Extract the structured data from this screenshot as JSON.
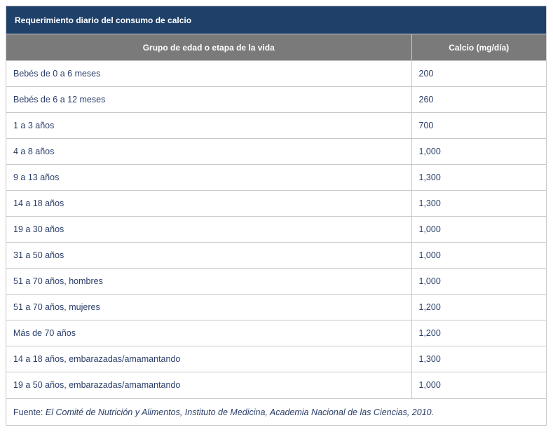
{
  "caption": "Requerimiento diario del consumo de calcio",
  "headers": {
    "group": "Grupo de edad o etapa de la vida",
    "calcium": "Calcio (mg/día)"
  },
  "rows": [
    {
      "group": "Bebés de 0 a 6 meses",
      "calcium": "200"
    },
    {
      "group": "Bebés de 6 a 12 meses",
      "calcium": "260"
    },
    {
      "group": "1 a 3 años",
      "calcium": "700"
    },
    {
      "group": "4 a 8 años",
      "calcium": "1,000"
    },
    {
      "group": "9 a 13 años",
      "calcium": "1,300"
    },
    {
      "group": "14 a 18 años",
      "calcium": "1,300"
    },
    {
      "group": "19 a 30 años",
      "calcium": "1,000"
    },
    {
      "group": "31 a 50 años",
      "calcium": "1,000"
    },
    {
      "group": "51 a 70 años, hombres",
      "calcium": "1,000"
    },
    {
      "group": "51 a 70 años, mujeres",
      "calcium": "1,200"
    },
    {
      "group": "Más de 70 años",
      "calcium": "1,200"
    },
    {
      "group": "14 a 18 años, embarazadas/amamantando",
      "calcium": "1,300"
    },
    {
      "group": "19 a 50 años, embarazadas/amamantando",
      "calcium": "1,000"
    }
  ],
  "source": {
    "label": "Fuente: ",
    "text": "El Comité de Nutrición y Alimentos, Instituto de Medicina, Academia Nacional de las Ciencias, 2010."
  }
}
